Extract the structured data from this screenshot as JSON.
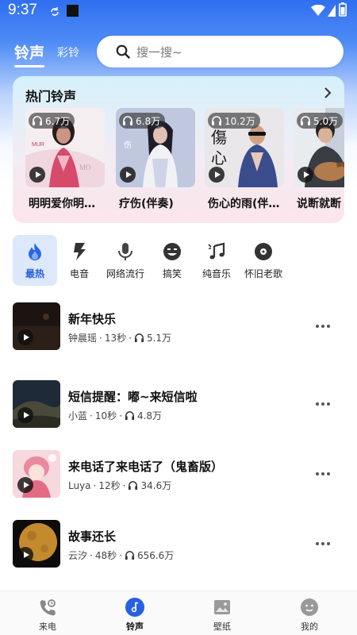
{
  "status_bar": {
    "time": "9:37"
  },
  "header": {
    "tabs": [
      {
        "label": "铃声",
        "active": true
      },
      {
        "label": "彩铃",
        "active": false
      }
    ],
    "search": {
      "placeholder": "搜一搜~"
    }
  },
  "hot": {
    "title": "热门铃声",
    "items": [
      {
        "plays": "6.7万",
        "name": "明明爱你明…"
      },
      {
        "plays": "6.8万",
        "name": "疗伤(伴奏)"
      },
      {
        "plays": "10.2万",
        "name": "伤心的雨(伴…"
      },
      {
        "plays": "5.0万",
        "name": "说断就断"
      }
    ]
  },
  "categories": [
    {
      "label": "最热",
      "icon": "fire-icon",
      "active": true
    },
    {
      "label": "电音",
      "icon": "lightning-icon",
      "active": false
    },
    {
      "label": "网络流行",
      "icon": "microphone-icon",
      "active": false
    },
    {
      "label": "搞笑",
      "icon": "smile-icon",
      "active": false
    },
    {
      "label": "纯音乐",
      "icon": "music-note-icon",
      "active": false
    },
    {
      "label": "怀旧老歌",
      "icon": "vinyl-disc-icon",
      "active": false
    }
  ],
  "songs": [
    {
      "title": "新年快乐",
      "artist": "钟晨瑶",
      "duration": "13秒",
      "plays": "5.1万"
    },
    {
      "title": "短信提醒：嘟~来短信啦",
      "artist": "小蓝",
      "duration": "10秒",
      "plays": "4.8万"
    },
    {
      "title": "来电话了来电话了（鬼畜版）",
      "artist": "Luya",
      "duration": "12秒",
      "plays": "34.6万"
    },
    {
      "title": "故事还长",
      "artist": "云汐",
      "duration": "48秒",
      "plays": "656.6万"
    }
  ],
  "bottom_nav": [
    {
      "label": "来电",
      "icon": "phone-icon",
      "active": false
    },
    {
      "label": "铃声",
      "icon": "music-note-icon",
      "active": true
    },
    {
      "label": "壁纸",
      "icon": "image-icon",
      "active": false
    },
    {
      "label": "我的",
      "icon": "user-face-icon",
      "active": false
    }
  ],
  "colors": {
    "accent": "#2760e0",
    "header_blue": "#2f6ff0"
  }
}
